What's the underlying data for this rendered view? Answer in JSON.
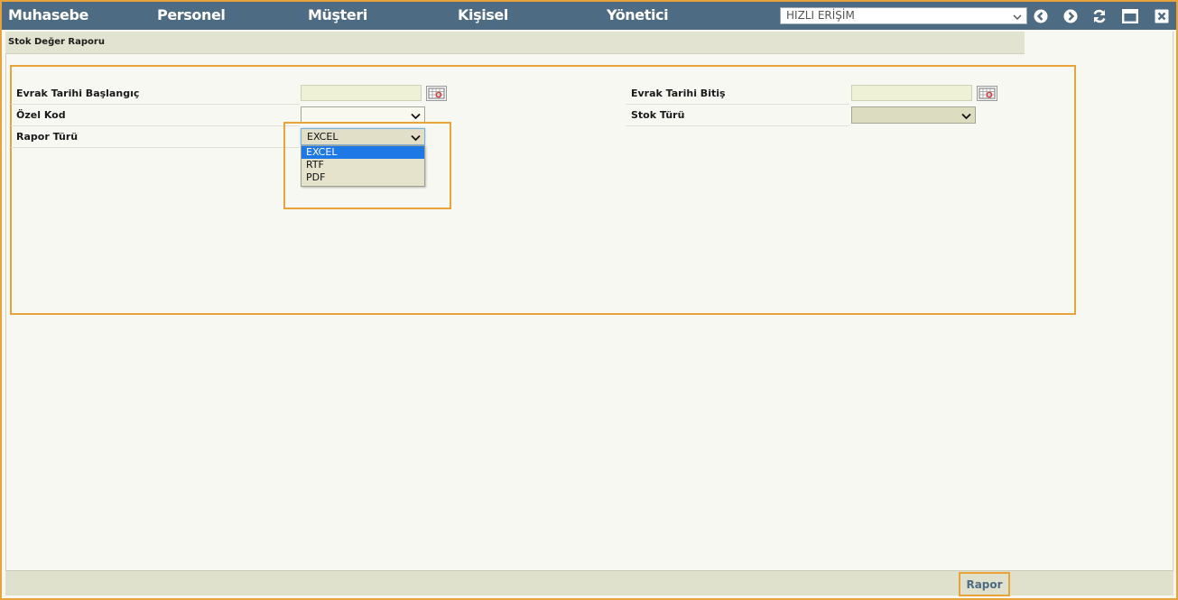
{
  "nav": {
    "items": [
      "Muhasebe",
      "Personel",
      "Müşteri",
      "Kişisel",
      "Yönetici"
    ],
    "quick_access": "HIZLI ERİŞİM"
  },
  "toolbar_icons": [
    "back-icon",
    "forward-icon",
    "refresh-icon",
    "maximize-icon",
    "close-icon"
  ],
  "page": {
    "title": "Stok Değer Raporu"
  },
  "form": {
    "start_date_label": "Evrak Tarihi Başlangıç",
    "end_date_label": "Evrak Tarihi Bitiş",
    "special_code_label": "Özel Kod",
    "stock_type_label": "Stok Türü",
    "report_type_label": "Rapor Türü",
    "start_date_value": "",
    "end_date_value": "",
    "special_code_value": "",
    "stock_type_value": "",
    "report_type_value": "EXCEL",
    "report_type_options": [
      "EXCEL",
      "RTF",
      "PDF"
    ],
    "report_type_selected_index": 0
  },
  "footer": {
    "report_button": "Rapor"
  },
  "colors": {
    "topbar": "#4e6b84",
    "highlight": "#e8a33a",
    "input_bg": "#eff1d6",
    "selected_option": "#1e78e6"
  }
}
